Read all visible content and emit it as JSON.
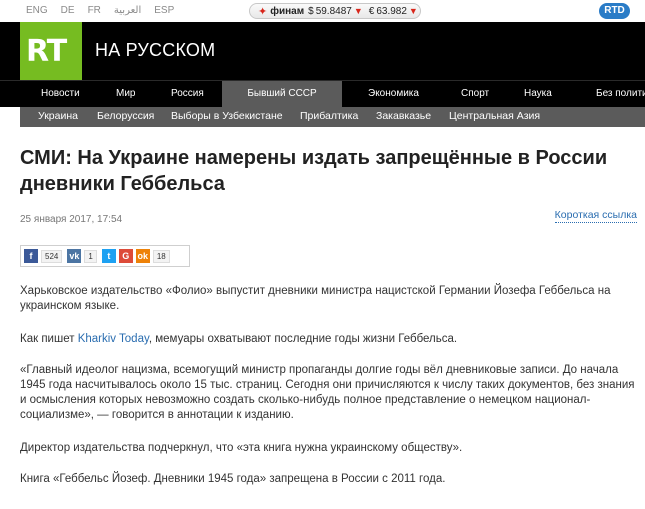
{
  "top": {
    "languages": [
      "ENG",
      "DE",
      "FR",
      "العربية",
      "ESP"
    ],
    "rates": {
      "provider": "финам",
      "usd": "59.8487",
      "eur": "63.982"
    },
    "rtd": "RTD"
  },
  "header": {
    "logo": "RT",
    "brand": "НА РУССКОМ"
  },
  "main_nav": [
    "Новости",
    "Мир",
    "Россия",
    "Бывший СССР",
    "Экономика",
    "Спорт",
    "Наука",
    "Без полити"
  ],
  "sub_nav": [
    "Украина",
    "Белоруссия",
    "Выборы в Узбекистане",
    "Прибалтика",
    "Закавказье",
    "Центральная Азия"
  ],
  "article": {
    "title": "СМИ: На Украине намерены издать запрещённые в России дневники Геббельса",
    "date": "25 января 2017, 17:54",
    "short_link": "Короткая ссылка",
    "share": {
      "fb_count": "524",
      "vk_count": "1",
      "ok_count": "18"
    },
    "p1": "Харьковское издательство «Фолио» выпустит дневники министра нацистской Германии Йозефа Геббельса на украинском языке.",
    "p2_pre": "Как пишет ",
    "p2_link": "Kharkiv Today",
    "p2_post": ", мемуары охватывают последние годы жизни Геббельса.",
    "p3": "«Главный идеолог нацизма, всемогущий министр пропаганды долгие годы вёл дневниковые записи. До начала 1945 года насчитывалось около 15 тыс. страниц. Сегодня они причисляются к числу таких документов, без знания и осмысления которых невозможно создать сколько-нибудь полное представление о немецком национал-социализме», — говорится в аннотации к изданию.",
    "p4": "Директор издательства подчеркнул, что «эта книга нужна украинскому обществу».",
    "p5": "Книга «Геббельс Йозеф. Дневники 1945 года» запрещена в России с 2011 года."
  }
}
